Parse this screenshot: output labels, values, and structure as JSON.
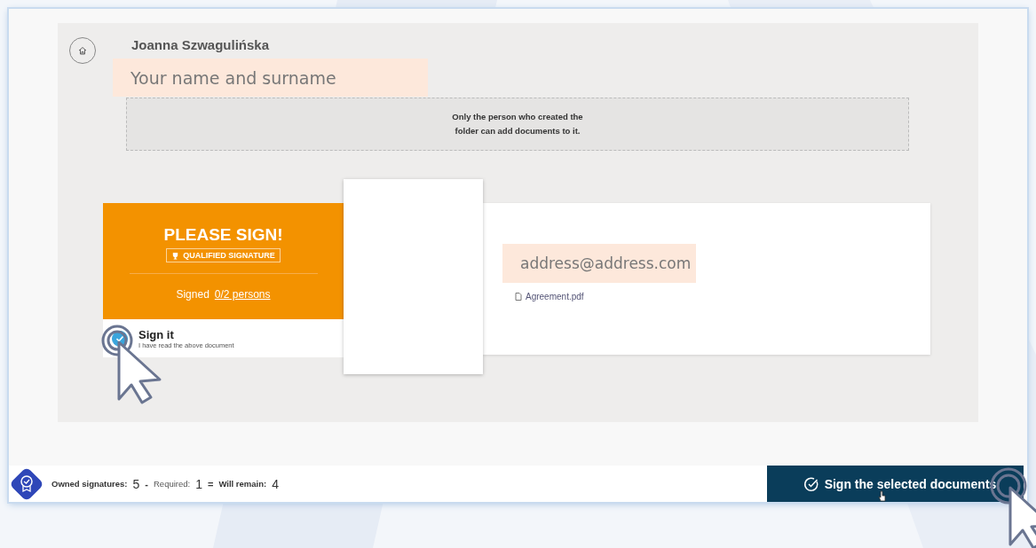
{
  "user": {
    "name": "Joanna Szwagulińska",
    "hint": "Your name and surname"
  },
  "dropzone": {
    "message": "Only the person who created the folder can add documents to it."
  },
  "document": {
    "status": "PLEASE SIGN!",
    "signature_type": "QUALIFIED SIGNATURE",
    "signed_label": "Signed",
    "signed_count": "0/2 persons",
    "sign_title": "Sign it",
    "sign_note": "I have read the above document",
    "checked": true,
    "email_hint": "address@address.com",
    "file": "Agreement.pdf"
  },
  "footer": {
    "owned_label": "Owned signatures:",
    "owned": "5",
    "minus": "-",
    "required_label": "Required:",
    "required": "1",
    "equals": "=",
    "remain_label": "Will remain:",
    "remain": "4",
    "button": "Sign the selected documents"
  }
}
